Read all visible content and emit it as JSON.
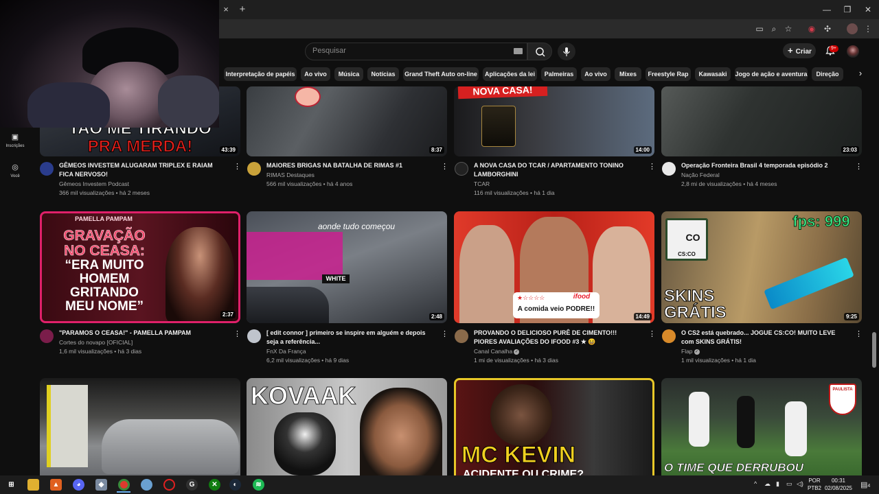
{
  "browser": {
    "tab_close": "×",
    "new_tab": "+",
    "window_controls": [
      "—",
      "❐",
      "✕"
    ]
  },
  "header": {
    "search_placeholder": "Pesquisar",
    "create_label": "Criar",
    "notification_count": "9+"
  },
  "chips": [
    "Interpretação de papéis",
    "Ao vivo",
    "Música",
    "Notícias",
    "Grand Theft Auto on-line",
    "Aplicações da lei",
    "Palmeiras",
    "Ao vivo",
    "Mixes",
    "Freestyle Rap",
    "Kawasaki",
    "Jogo de ação e aventura",
    "Direção"
  ],
  "sidebar": {
    "subscriptions": "Inscrições",
    "you": "Você"
  },
  "videos": [
    {
      "thumb_text": [
        "TAO ME TIRANDO",
        "PRA MERDA!"
      ],
      "duration": "43:39",
      "title": "GÊMEOS INVESTEM ALUGARAM TRIPLEX E RAIAM FICA NERVOSO!",
      "channel": "Gêmeos Investem Podcast",
      "stats": "366 mil visualizações • há 2 meses"
    },
    {
      "duration": "8:37",
      "title": "MAIORES BRIGAS NA BATALHA DE RIMAS #1",
      "channel": "RIMAS Destaques",
      "stats": "566 mil visualizações • há 4 anos"
    },
    {
      "thumb_text": [
        "NOVA CASA!"
      ],
      "duration": "14:00",
      "title": "A NOVA CASA DO TCAR / APARTAMENTO TONINO LAMBORGHINI",
      "channel": "TCAR",
      "stats": "116 mil visualizações • há 1 dia"
    },
    {
      "duration": "23:03",
      "title": "Operação Fronteira Brasil 4 temporada episódio 2",
      "channel": "Nação Federal",
      "stats": "2,8 mi de visualizações • há 4 meses"
    },
    {
      "thumb_text": [
        "PAMELLA PAMPAM",
        "GRAVAÇÃO",
        "NO CEASA:",
        "“ERA MUITO",
        "HOMEM",
        "GRITANDO",
        "MEU NOME”"
      ],
      "duration": "2:37",
      "title": "\"PARAMOS O CEASA!\" - PAMELLA PAMPAM",
      "channel": "Cortes do novapo [OFICIAL]",
      "stats": "1,6 mil visualizações • há 3 dias"
    },
    {
      "thumb_text": [
        "aonde tudo começou",
        "WHITE"
      ],
      "duration": "2:48",
      "title": "[ edit connor ] primeiro se inspire em alguém e depois seja a referência...",
      "channel": "FnX Da França",
      "stats": "6,2 mil visualizações • há 9 dias"
    },
    {
      "thumb_text": [
        "ifood",
        "A comida veio PODRE!!"
      ],
      "duration": "14:49",
      "title": "PROVANDO O DELICIOSO PURÊ DE CIMENTO!!! PIORES AVALIAÇÕES DO IFOOD #3 ★ 😆",
      "channel": "Canal Canalha",
      "stats": "1 mi de visualizações • há 3 dias"
    },
    {
      "thumb_text": [
        "fps: 999",
        "CO",
        "CS:CO",
        "SKINS",
        "GRÁTIS"
      ],
      "duration": "9:25",
      "title": "O CS2 está quebrado... JOGUE CS:CO! MUITO LEVE com SKINS GRÁTIS!",
      "channel": "Flap",
      "stats": "1 mil visualizações • há 1 dia"
    },
    {},
    {
      "thumb_text": [
        "KOVAAK"
      ]
    },
    {
      "thumb_text": [
        "MC KEVIN",
        "ACIDENTE OU CRIME?"
      ]
    },
    {
      "thumb_text": [
        "O TIME QUE DERRUBOU",
        "PAULISTA"
      ]
    }
  ],
  "taskbar": {
    "lang_1": "POR",
    "lang_2": "PTB2",
    "time": "00:31",
    "date": "02/08/2025",
    "notif_count": "4"
  },
  "colors": {
    "accent": "#cc0000",
    "background": "#0f0f0f",
    "chip": "#272727"
  }
}
